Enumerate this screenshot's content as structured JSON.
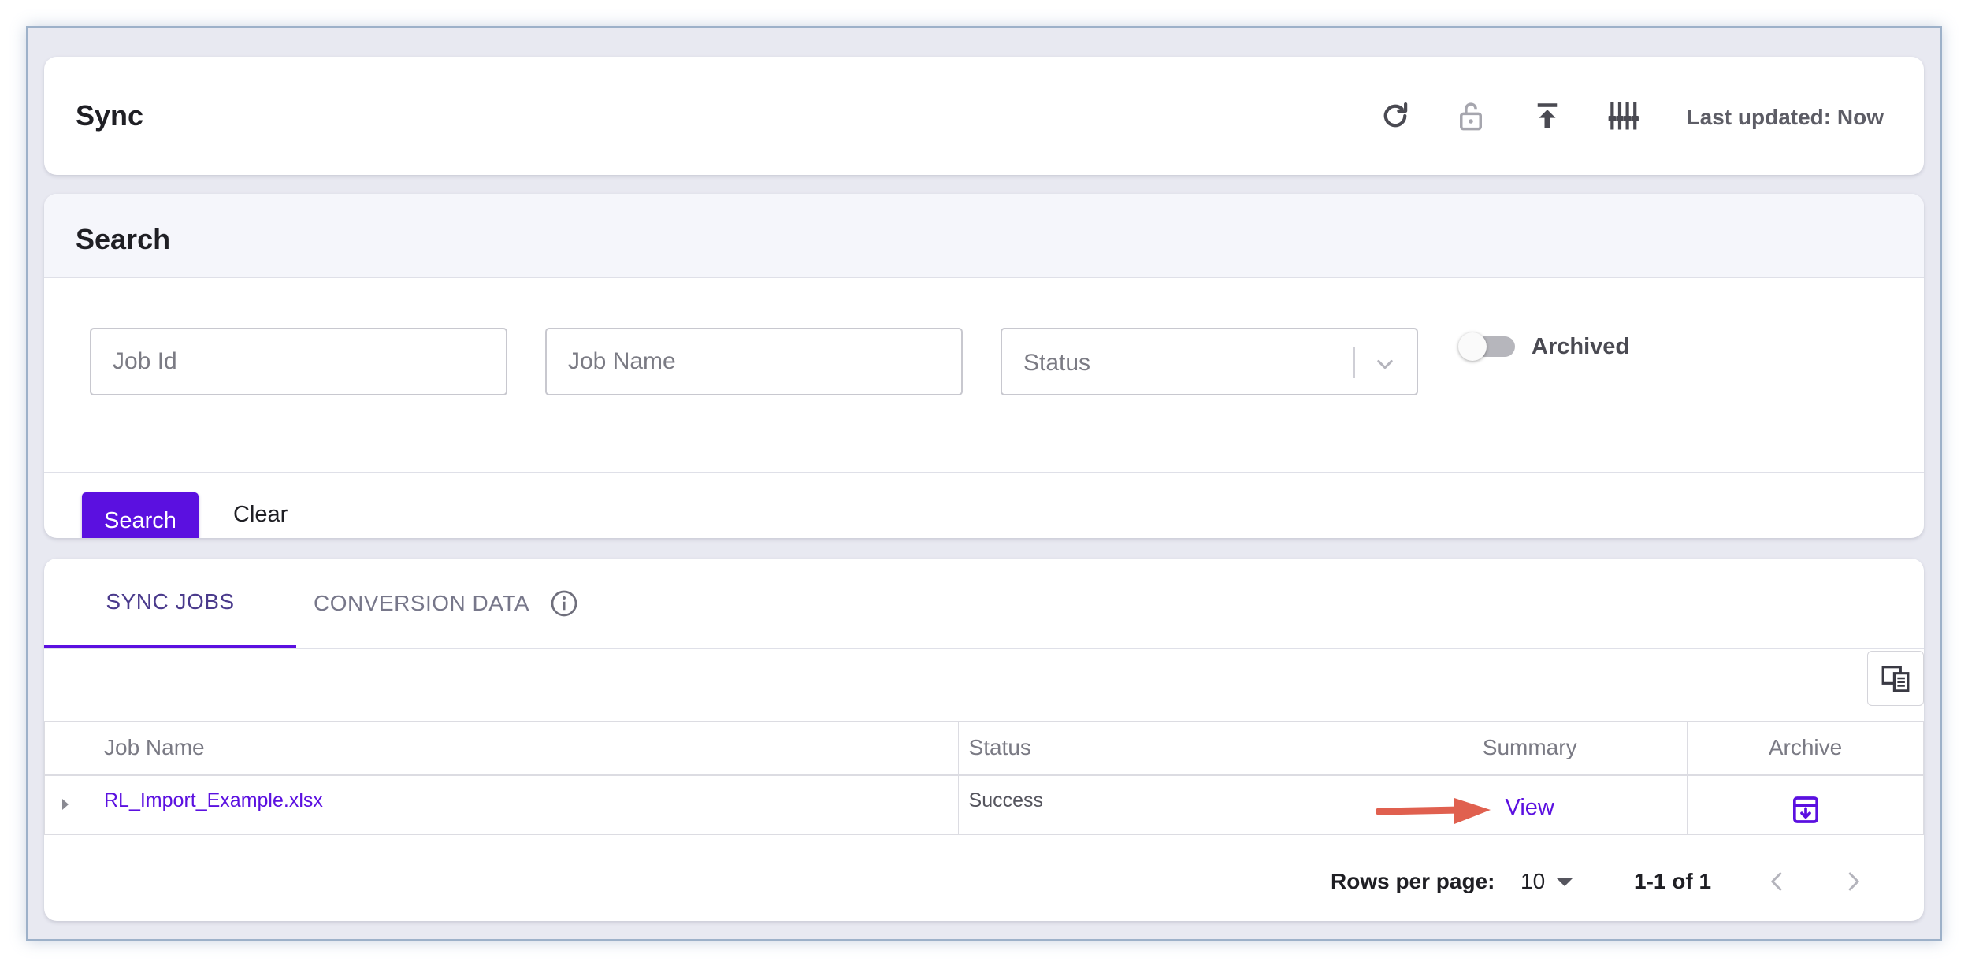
{
  "header": {
    "title": "Sync",
    "last_updated": "Last updated: Now",
    "icons": [
      "refresh-icon",
      "unlock-icon",
      "upload-icon",
      "filter-sliders-icon"
    ]
  },
  "search": {
    "title": "Search",
    "job_id_placeholder": "Job Id",
    "job_name_placeholder": "Job Name",
    "status_placeholder": "Status",
    "archived_label": "Archived",
    "search_button": "Search",
    "clear_button": "Clear"
  },
  "tabs": {
    "sync_jobs": "SYNC JOBS",
    "conversion_data": "CONVERSION DATA"
  },
  "table": {
    "headers": {
      "job_name": "Job Name",
      "status": "Status",
      "summary": "Summary",
      "archive": "Archive"
    },
    "rows": [
      {
        "job_name": "RL_Import_Example.xlsx",
        "status": "Success",
        "summary": "View"
      }
    ]
  },
  "pagination": {
    "rows_per_page_label": "Rows per page:",
    "rows_per_page": "10",
    "range": "1-1 of 1"
  },
  "colors": {
    "accent": "#5b10e0",
    "annotation_arrow": "#e0604f"
  }
}
